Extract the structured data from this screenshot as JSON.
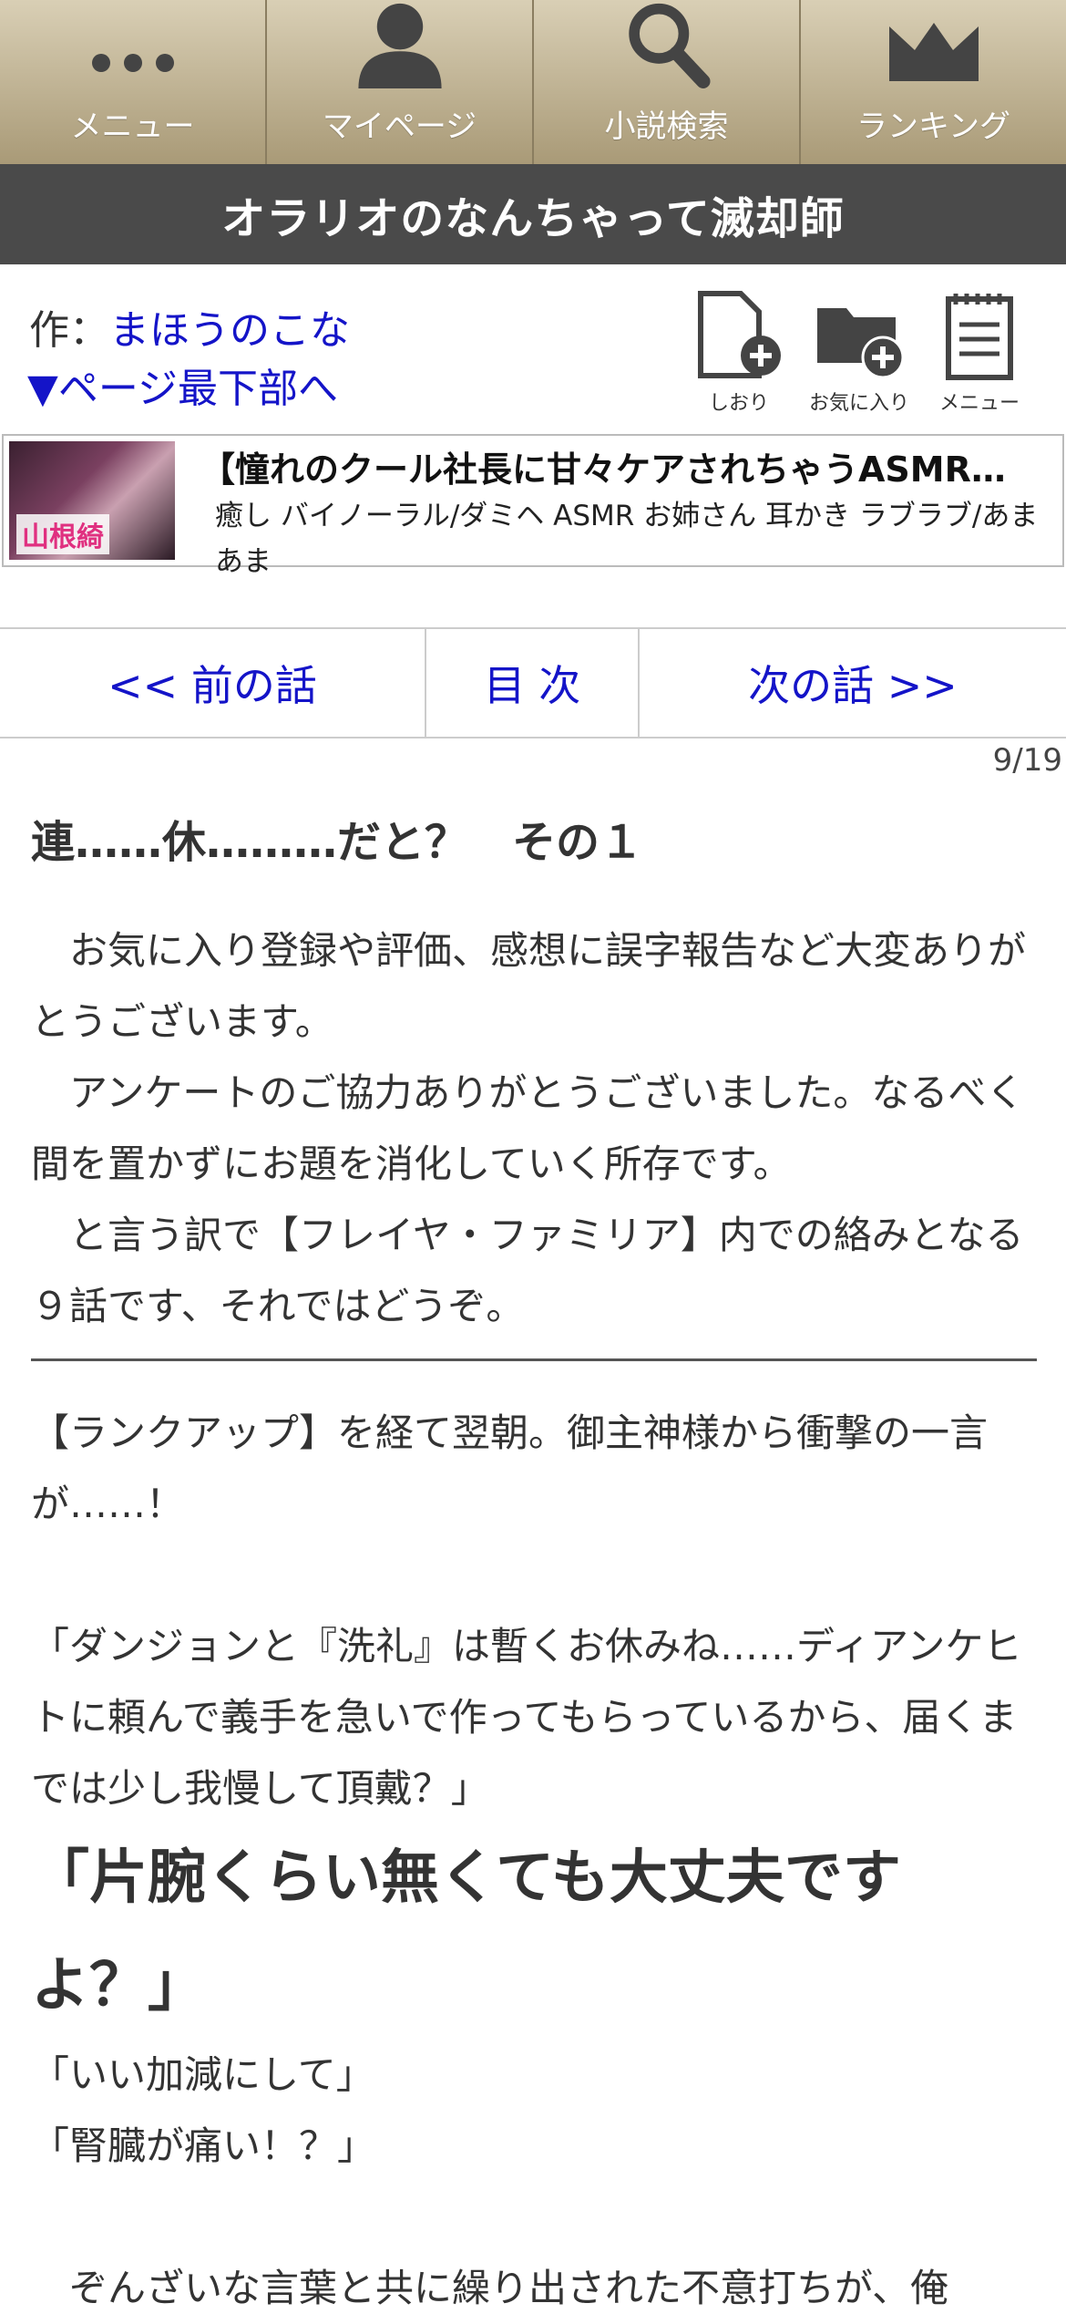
{
  "topnav": [
    {
      "label": "メニュー",
      "icon": "dots-icon"
    },
    {
      "label": "マイページ",
      "icon": "user-icon"
    },
    {
      "label": "小説検索",
      "icon": "search-icon"
    },
    {
      "label": "ランキング",
      "icon": "crown-icon"
    }
  ],
  "novel_title": "オラリオのなんちゃって滅却師",
  "author_prefix": "作：",
  "author_name": "まほうのこな",
  "to_bottom": "▼ページ最下部へ",
  "tools": [
    {
      "label": "しおり",
      "icon": "bookmark-add-icon"
    },
    {
      "label": "お気に入り",
      "icon": "favorite-folder-icon"
    },
    {
      "label": "メニュー",
      "icon": "notepad-icon"
    }
  ],
  "ad": {
    "thumb_text": "山根綺",
    "title": "【憧れのクール社長に甘々ケアされちゃうASMR…",
    "tags": "癒し バイノーラル/ダミヘ ASMR お姉さん 耳かき ラブラブ/あまあま"
  },
  "chapter_nav": {
    "prev": "<< 前の話",
    "toc": "目 次",
    "next": "次の話 >>"
  },
  "page_count": "9/19",
  "chapter_title": "連……休………だと？　その１",
  "preface": [
    "　お気に入り登録や評価、感想に誤字報告など大変ありがとうございます。",
    "　アンケートのご協力ありがとうございました。なるべく間を置かずにお題を消化していく所存です。",
    "　と言う訳で【フレイヤ・ファミリア】内での絡みとなる９話です、それではどうぞ。"
  ],
  "body": {
    "p1": "【ランクアップ】を経て翌朝。御主神様から衝撃の一言が……！",
    "p2": "「ダンジョンと『洗礼』は暫くお休みね……ディアンケヒトに頼んで義手を急いで作ってもらっているから、届くまでは少し我慢して頂戴？」",
    "p3": "「片腕くらい無くても大丈夫ですよ？」",
    "p4": "「いい加減にして」",
    "p5": "「腎臓が痛い！？」",
    "p6": "　ぞんざいな言葉と共に繰り出された不意打ちが、俺"
  }
}
